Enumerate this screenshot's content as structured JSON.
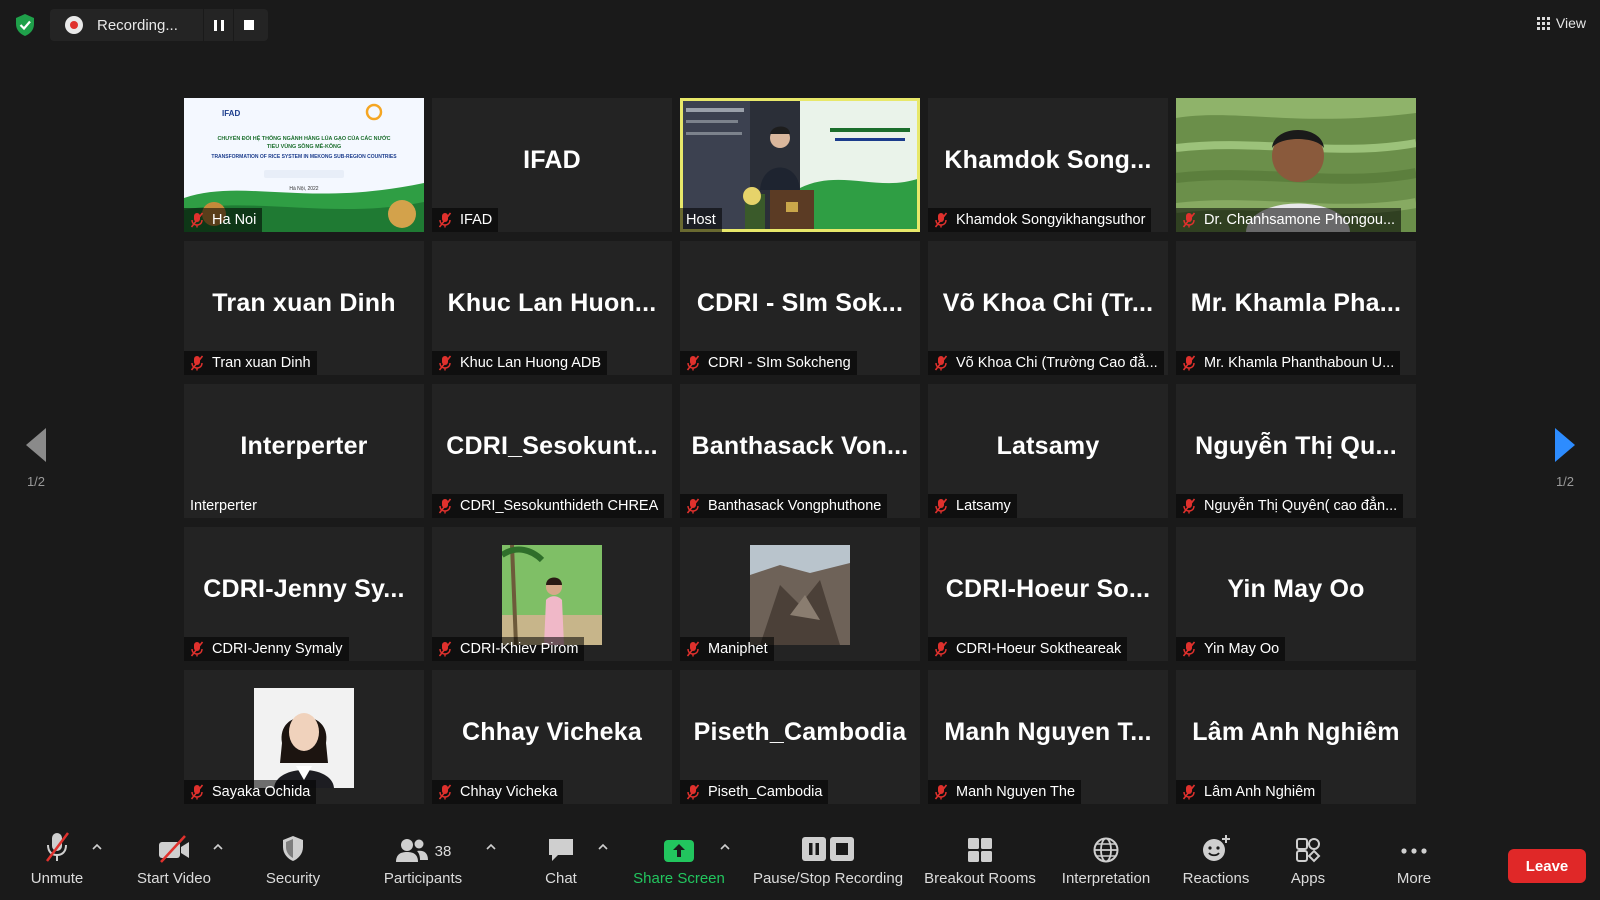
{
  "recording": {
    "status": "Recording..."
  },
  "view": {
    "label": "View"
  },
  "pager": {
    "left": "1/2",
    "right": "1/2"
  },
  "tiles": [
    {
      "big": "",
      "label": "Ha Noi",
      "muted": true,
      "kind": "banner"
    },
    {
      "big": "IFAD",
      "label": "IFAD",
      "muted": true
    },
    {
      "big": "",
      "label": "Host",
      "muted": false,
      "kind": "stage",
      "active": true
    },
    {
      "big": "Khamdok Song...",
      "label": "Khamdok Songyikhangsuthor",
      "muted": true
    },
    {
      "big": "",
      "label": "Dr. Chanhsamone Phongou...",
      "muted": true,
      "kind": "portrait-field"
    },
    {
      "big": "Tran xuan Dinh",
      "label": "Tran xuan Dinh",
      "muted": true
    },
    {
      "big": "Khuc Lan Huon...",
      "label": "Khuc Lan Huong ADB",
      "muted": true
    },
    {
      "big": "CDRI - SIm Sok...",
      "label": "CDRI - SIm Sokcheng",
      "muted": true
    },
    {
      "big": "Võ Khoa Chi (Tr...",
      "label": "Võ Khoa Chi (Trường Cao đẳ...",
      "muted": true
    },
    {
      "big": "Mr. Khamla Pha...",
      "label": "Mr. Khamla Phanthaboun U...",
      "muted": true
    },
    {
      "big": "Interperter",
      "label": "Interperter",
      "muted": false
    },
    {
      "big": "CDRI_Sesokunt...",
      "label": "CDRI_Sesokunthideth CHREA",
      "muted": true
    },
    {
      "big": "Banthasack Von...",
      "label": "Banthasack Vongphuthone",
      "muted": true
    },
    {
      "big": "Latsamy",
      "label": "Latsamy",
      "muted": true
    },
    {
      "big": "Nguyễn Thị Qu...",
      "label": "Nguyễn Thị Quyên( cao đẳn...",
      "muted": true
    },
    {
      "big": "CDRI-Jenny Sy...",
      "label": "CDRI-Jenny Symaly",
      "muted": true
    },
    {
      "big": "",
      "label": "CDRI-Khiev Pirom",
      "muted": true,
      "kind": "thumb-palm"
    },
    {
      "big": "",
      "label": "Maniphet",
      "muted": true,
      "kind": "thumb-rock"
    },
    {
      "big": "CDRI-Hoeur So...",
      "label": "CDRI-Hoeur Soktheareak",
      "muted": true
    },
    {
      "big": "Yin May Oo",
      "label": "Yin May Oo",
      "muted": true
    },
    {
      "big": "",
      "label": "Sayaka Ochida",
      "muted": true,
      "kind": "thumb-person"
    },
    {
      "big": "Chhay Vicheka",
      "label": "Chhay Vicheka",
      "muted": true
    },
    {
      "big": "Piseth_Cambodia",
      "label": "Piseth_Cambodia",
      "muted": true
    },
    {
      "big": "Manh Nguyen T...",
      "label": "Manh Nguyen The",
      "muted": true
    },
    {
      "big": "Lâm Anh Nghiêm",
      "label": "Lâm Anh Nghiêm",
      "muted": true
    }
  ],
  "banner": {
    "org": "IFAD",
    "title_vi": "CHUYỂN ĐỔI HỆ THỐNG NGÀNH HÀNG LÚA GẠO CỦA CÁC NƯỚC",
    "subtitle_vi": "TIỂU VÙNG SÔNG MÊ-KÔNG",
    "title_en": "TRANSFORMATION OF RICE SYSTEM IN MEKONG SUB-REGION COUNTRIES",
    "place": "Hà Nội, 2022"
  },
  "toolbar": {
    "unmute": "Unmute",
    "start_video": "Start Video",
    "security": "Security",
    "participants": "Participants",
    "participants_count": "38",
    "chat": "Chat",
    "share_screen": "Share Screen",
    "pause_stop": "Pause/Stop Recording",
    "breakout": "Breakout Rooms",
    "interpretation": "Interpretation",
    "reactions": "Reactions",
    "apps": "Apps",
    "more": "More",
    "leave": "Leave"
  },
  "colors": {
    "background": "#1a1a1a",
    "tile": "#232323",
    "accent": "#2d8cff",
    "share": "#22c55e",
    "leave": "#e02828",
    "mute": "#e0312d",
    "active_border": "#e8e86a"
  }
}
